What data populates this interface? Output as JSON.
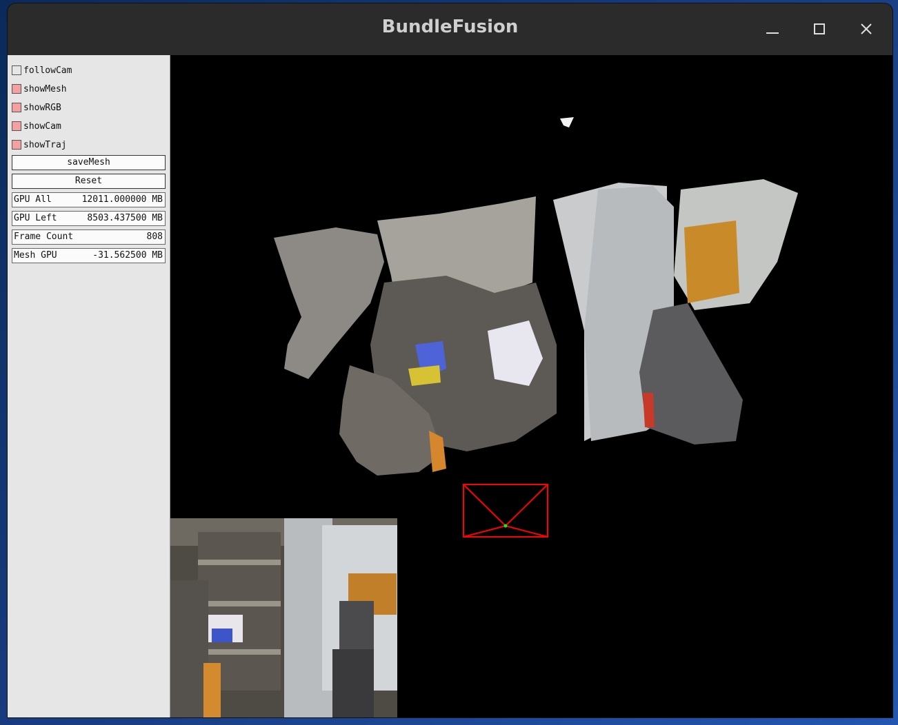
{
  "window": {
    "title": "BundleFusion"
  },
  "controls": {
    "checkboxes": [
      {
        "label": "followCam",
        "checked": false
      },
      {
        "label": "showMesh",
        "checked": true
      },
      {
        "label": "showRGB",
        "checked": true
      },
      {
        "label": "showCam",
        "checked": true
      },
      {
        "label": "showTraj",
        "checked": true
      }
    ],
    "buttons": {
      "save_mesh": "saveMesh",
      "reset": "Reset"
    },
    "stats": [
      {
        "label": "GPU All",
        "value": "12011.000000 MB"
      },
      {
        "label": "GPU Left",
        "value": "8503.437500 MB"
      },
      {
        "label": "Frame Count",
        "value": "808"
      },
      {
        "label": "Mesh GPU",
        "value": "-31.562500 MB"
      }
    ]
  },
  "colors": {
    "checkbox_on": "#f2a0a0",
    "camera_frustum": "#ff0000",
    "camera_center": "#00ff00"
  }
}
